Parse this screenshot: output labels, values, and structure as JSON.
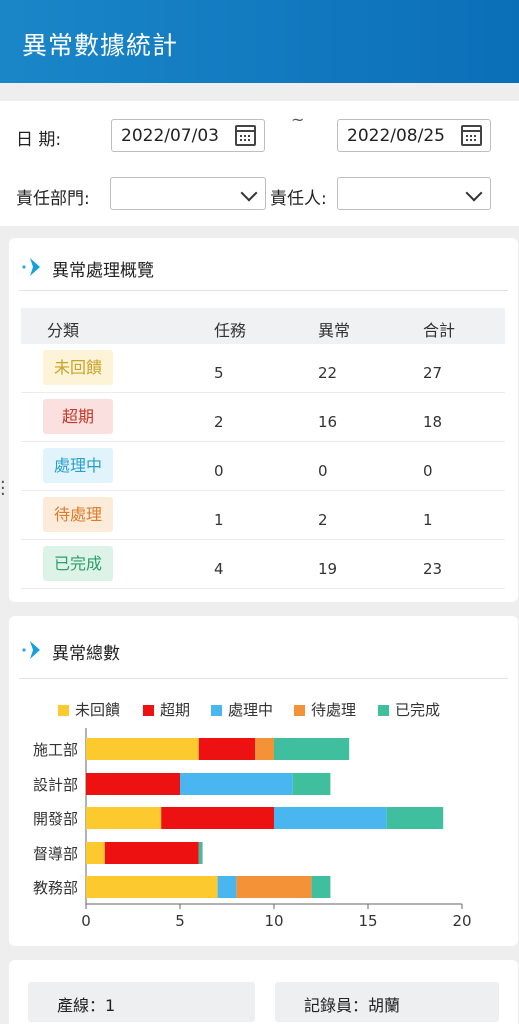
{
  "header": {
    "title": "異常數據統計"
  },
  "filters": {
    "date_label": "日    期:",
    "date_from": "2022/07/03",
    "date_separator": "~",
    "date_to": "2022/08/25",
    "dept_label": "責任部門:",
    "dept_value": "",
    "person_label": "責任人:",
    "person_value": ""
  },
  "overview": {
    "title": "異常處理概覽",
    "columns": [
      "分類",
      "任務",
      "異常",
      "合計"
    ],
    "rows": [
      {
        "category": "未回饋",
        "task": "5",
        "abnormal": "22",
        "total": "27",
        "color": "#c9a227",
        "bg": "#fdf3d6"
      },
      {
        "category": "超期",
        "task": "2",
        "abnormal": "16",
        "total": "18",
        "color": "#c0392b",
        "bg": "#fbe0e0"
      },
      {
        "category": "處理中",
        "task": "0",
        "abnormal": "0",
        "total": "0",
        "color": "#2b9fc9",
        "bg": "#e1f3fb"
      },
      {
        "category": "待處理",
        "task": "1",
        "abnormal": "2",
        "total": "1",
        "color": "#e07b2a",
        "bg": "#fdebd9"
      },
      {
        "category": "已完成",
        "task": "4",
        "abnormal": "19",
        "total": "23",
        "color": "#2e9e6a",
        "bg": "#ddf3e8"
      }
    ]
  },
  "total_card": {
    "title": "異常總數"
  },
  "chart_data": {
    "type": "bar",
    "orientation": "horizontal",
    "stacked": true,
    "categories": [
      "施工部",
      "設計部",
      "開發部",
      "督導部",
      "教務部"
    ],
    "series": [
      {
        "name": "未回饋",
        "color": "#fcc92f",
        "values": [
          6,
          0,
          4,
          1,
          7
        ]
      },
      {
        "name": "超期",
        "color": "#ee1111",
        "values": [
          3,
          5,
          6,
          5,
          0
        ]
      },
      {
        "name": "處理中",
        "color": "#4ab6f0",
        "values": [
          0,
          6,
          6,
          0,
          1
        ]
      },
      {
        "name": "待處理",
        "color": "#f39236",
        "values": [
          1,
          0,
          0,
          0,
          4
        ]
      },
      {
        "name": "已完成",
        "color": "#3fbf9d",
        "values": [
          4,
          2,
          3,
          0.2,
          1
        ]
      }
    ],
    "xlim": [
      0,
      20
    ],
    "xticks": [
      "0",
      "5",
      "10",
      "15",
      "20"
    ],
    "legend_position": "top"
  },
  "bottom": {
    "line_label": "產線：1",
    "recorder_label": "記錄員：胡蘭"
  }
}
